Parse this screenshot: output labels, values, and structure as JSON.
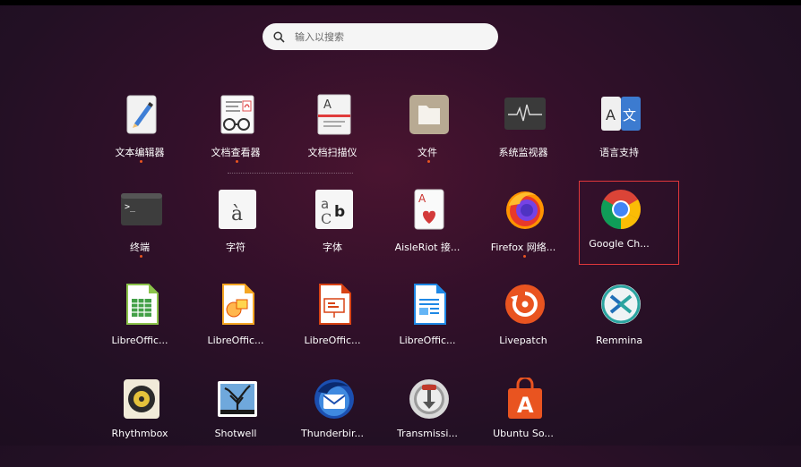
{
  "search": {
    "placeholder": "输入以搜索"
  },
  "apps": [
    {
      "label": "文本编辑器",
      "running": true
    },
    {
      "label": "文档查看器",
      "running": true
    },
    {
      "label": "文档扫描仪",
      "running": false
    },
    {
      "label": "文件",
      "running": true
    },
    {
      "label": "系统监视器",
      "running": false
    },
    {
      "label": "语言支持",
      "running": false
    },
    {
      "label": "终端",
      "running": true
    },
    {
      "label": "字符",
      "running": false
    },
    {
      "label": "字体",
      "running": false
    },
    {
      "label": "AisleRiot 接...",
      "running": false
    },
    {
      "label": "Firefox 网络...",
      "running": true
    },
    {
      "label": "Google Ch...",
      "running": false,
      "selected": true
    },
    {
      "label": "LibreOffic...",
      "running": false
    },
    {
      "label": "LibreOffic...",
      "running": false
    },
    {
      "label": "LibreOffic...",
      "running": false
    },
    {
      "label": "LibreOffic...",
      "running": false
    },
    {
      "label": "Livepatch",
      "running": false
    },
    {
      "label": "Remmina",
      "running": false
    },
    {
      "label": "Rhythmbox",
      "running": false
    },
    {
      "label": "Shotwell",
      "running": false
    },
    {
      "label": "Thunderbir...",
      "running": false
    },
    {
      "label": "Transmissi...",
      "running": false
    },
    {
      "label": "Ubuntu So...",
      "running": false
    }
  ],
  "icons": [
    "text-editor-icon",
    "document-viewer-icon",
    "document-scanner-icon",
    "files-icon",
    "system-monitor-icon",
    "language-support-icon",
    "terminal-icon",
    "characters-icon",
    "fonts-icon",
    "aisleriot-icon",
    "firefox-icon",
    "google-chrome-icon",
    "libreoffice-calc-icon",
    "libreoffice-draw-icon",
    "libreoffice-impress-icon",
    "libreoffice-writer-icon",
    "livepatch-icon",
    "remmina-icon",
    "rhythmbox-icon",
    "shotwell-icon",
    "thunderbird-icon",
    "transmission-icon",
    "ubuntu-software-icon"
  ],
  "colors": {
    "accent": "#e95420",
    "selection_border": "#e0373b",
    "background": "#2c0e28"
  }
}
